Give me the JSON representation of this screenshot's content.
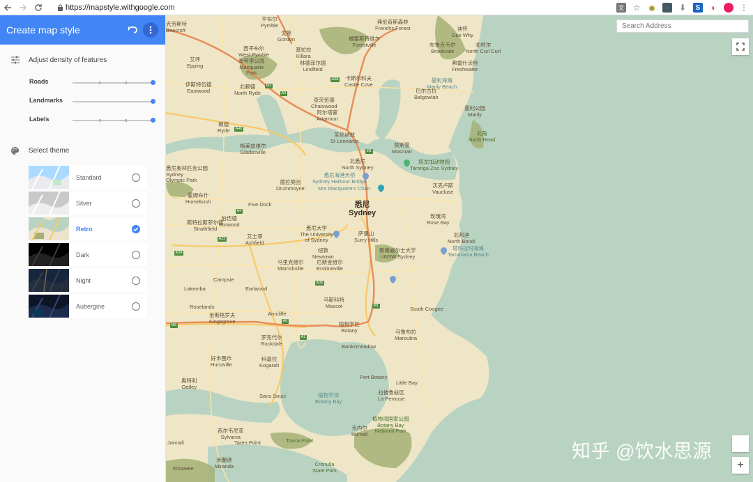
{
  "browser": {
    "url": "https://mapstyle.withgoogle.com"
  },
  "sidebar": {
    "title": "Create map style",
    "density": {
      "heading": "Adjust density of features",
      "sliders": [
        {
          "label": "Roads",
          "level": 1.0
        },
        {
          "label": "Landmarks",
          "level": 1.0
        },
        {
          "label": "Labels",
          "level": 1.0
        }
      ]
    },
    "themes": {
      "heading": "Select theme",
      "items": [
        {
          "name": "Standard",
          "selected": false
        },
        {
          "name": "Silver",
          "selected": false
        },
        {
          "name": "Retro",
          "selected": true
        },
        {
          "name": "Dark",
          "selected": false
        },
        {
          "name": "Night",
          "selected": false
        },
        {
          "name": "Aubergine",
          "selected": false
        }
      ]
    }
  },
  "map": {
    "search_placeholder": "Search Address",
    "zoom_in_label": "+",
    "colors": {
      "land": "#efe6c8",
      "water": "#b9d3c2",
      "park": "#a5b076",
      "road": "#f8c967",
      "highway": "#e9bc62",
      "major": "#e98d58"
    },
    "labels": [
      {
        "text": "克劳斯特\nBeecroft"
      },
      {
        "text": "平布尔\nPymble"
      },
      {
        "text": "戈登\nGordon"
      },
      {
        "text": "弗伦奇斯森林\nFrenchs Forest"
      },
      {
        "text": "迪怀\nDee Why"
      },
      {
        "text": "福雷斯特维尔\nForestville"
      },
      {
        "text": "布鲁克韦尔\nBrookvale"
      },
      {
        "text": "北柯尔\nNorth Curl Curl"
      },
      {
        "text": "弗雷什沃特\nFreshwater"
      },
      {
        "text": "西平布尔\nWest Pymble"
      },
      {
        "text": "麦夸里公园\nMacquarie\nPark"
      },
      {
        "text": "基拉拉\nKillara"
      },
      {
        "text": "林德菲尔德\nLindfield"
      },
      {
        "text": "卡斯尔科夫\nCastle Cove"
      },
      {
        "text": "艾坪\nEpping"
      },
      {
        "text": "伊斯特伍德\nEastwood"
      },
      {
        "text": "北赖德\nNorth Ryde"
      },
      {
        "text": "查茨伍德\nChatswood"
      },
      {
        "text": "阿尔塔蒙\nArtarmon"
      },
      {
        "text": "巴尔古拉\nBalgowlah"
      },
      {
        "text": "曼利海滩\nManly Beach"
      },
      {
        "text": "曼利公园\nManly"
      },
      {
        "text": "北角\nNorth Head"
      },
      {
        "text": "赖德\nRyde"
      },
      {
        "text": "圣伦纳兹\nSt Leonards"
      },
      {
        "text": "格莱兹维尔\nGladesville"
      },
      {
        "text": "莫斯曼\nMosman"
      },
      {
        "text": "北悉尼\nNorth Sydney"
      },
      {
        "text": "塔龙加动物园\nTaronga Zoo Sydney"
      },
      {
        "text": "沃克卢斯\nVaucluse"
      },
      {
        "text": "悉尼奥林匹克公园\nSydney\nOlympic Park"
      },
      {
        "text": "德拉莫因\nDrummoyne"
      },
      {
        "text": "悉尼海港大桥\nSydney Harbour Bridge"
      },
      {
        "text": "Mrs Macquarie's Chair"
      },
      {
        "text": "霍姆布什\nHomebush"
      },
      {
        "text": "Five Dock"
      },
      {
        "text": "悉尼\nSydney"
      },
      {
        "text": "玫瑰湾\nRose Bay"
      },
      {
        "text": "斯特拉斯菲尔德\nStrathfield"
      },
      {
        "text": "伯伍德\nBurwood"
      },
      {
        "text": "艾士菲\nAshfield"
      },
      {
        "text": "悉尼大学\nThe University\nof Sydney"
      },
      {
        "text": "萨里山\nSurry Hills"
      },
      {
        "text": "北邦迪\nNorth Bondi"
      },
      {
        "text": "塔玛拉玛海滩\nTamarama Beach"
      },
      {
        "text": "纽敦\nNewtown"
      },
      {
        "text": "新南威尔士大学\nUNSW Sydney"
      },
      {
        "text": "马里克维尔\nMarrickville"
      },
      {
        "text": "厄斯金维尔\nErskineville"
      },
      {
        "text": "Campsie"
      },
      {
        "text": "Earlwood"
      },
      {
        "text": "Lakemba"
      },
      {
        "text": "马斯科特\nMascot"
      },
      {
        "text": "Roselands"
      },
      {
        "text": "South Coogee"
      },
      {
        "text": "金斯格罗夫\nKingsgrove"
      },
      {
        "text": "Arncliffe"
      },
      {
        "text": "植物学区\nBotany"
      },
      {
        "text": "马鲁布拉\nMaroubra"
      },
      {
        "text": "罗克代尔\nRockdale"
      },
      {
        "text": "Banksmeadow"
      },
      {
        "text": "好市围市\nHurstville"
      },
      {
        "text": "科嘉拉\nKogarah"
      },
      {
        "text": "Port Botany"
      },
      {
        "text": "奥特利\nOatley"
      },
      {
        "text": "Sans Souci"
      },
      {
        "text": "植物学湾\nBotany Bay"
      },
      {
        "text": "Little Bay"
      },
      {
        "text": "拉彼鲁兹区\nLa Perouse"
      },
      {
        "text": "西尔韦尼亚\nSylvania"
      },
      {
        "text": "克内尔\nKurnell"
      },
      {
        "text": "植物湾国家公园\nBotany Bay\nNational Park"
      },
      {
        "text": "Taren Point"
      },
      {
        "text": "Towra Point"
      },
      {
        "text": "Jannali"
      },
      {
        "text": "米蘭達\nMiranda"
      },
      {
        "text": "Kirrawee"
      },
      {
        "text": "Cronulla\nState Park"
      }
    ],
    "route_shields": [
      "M2",
      "A38",
      "A3",
      "M1",
      "A40",
      "A4",
      "A22",
      "A34",
      "A36",
      "M5",
      "A6",
      "A1",
      "M1"
    ]
  },
  "watermark": "知乎 @饮水思源"
}
